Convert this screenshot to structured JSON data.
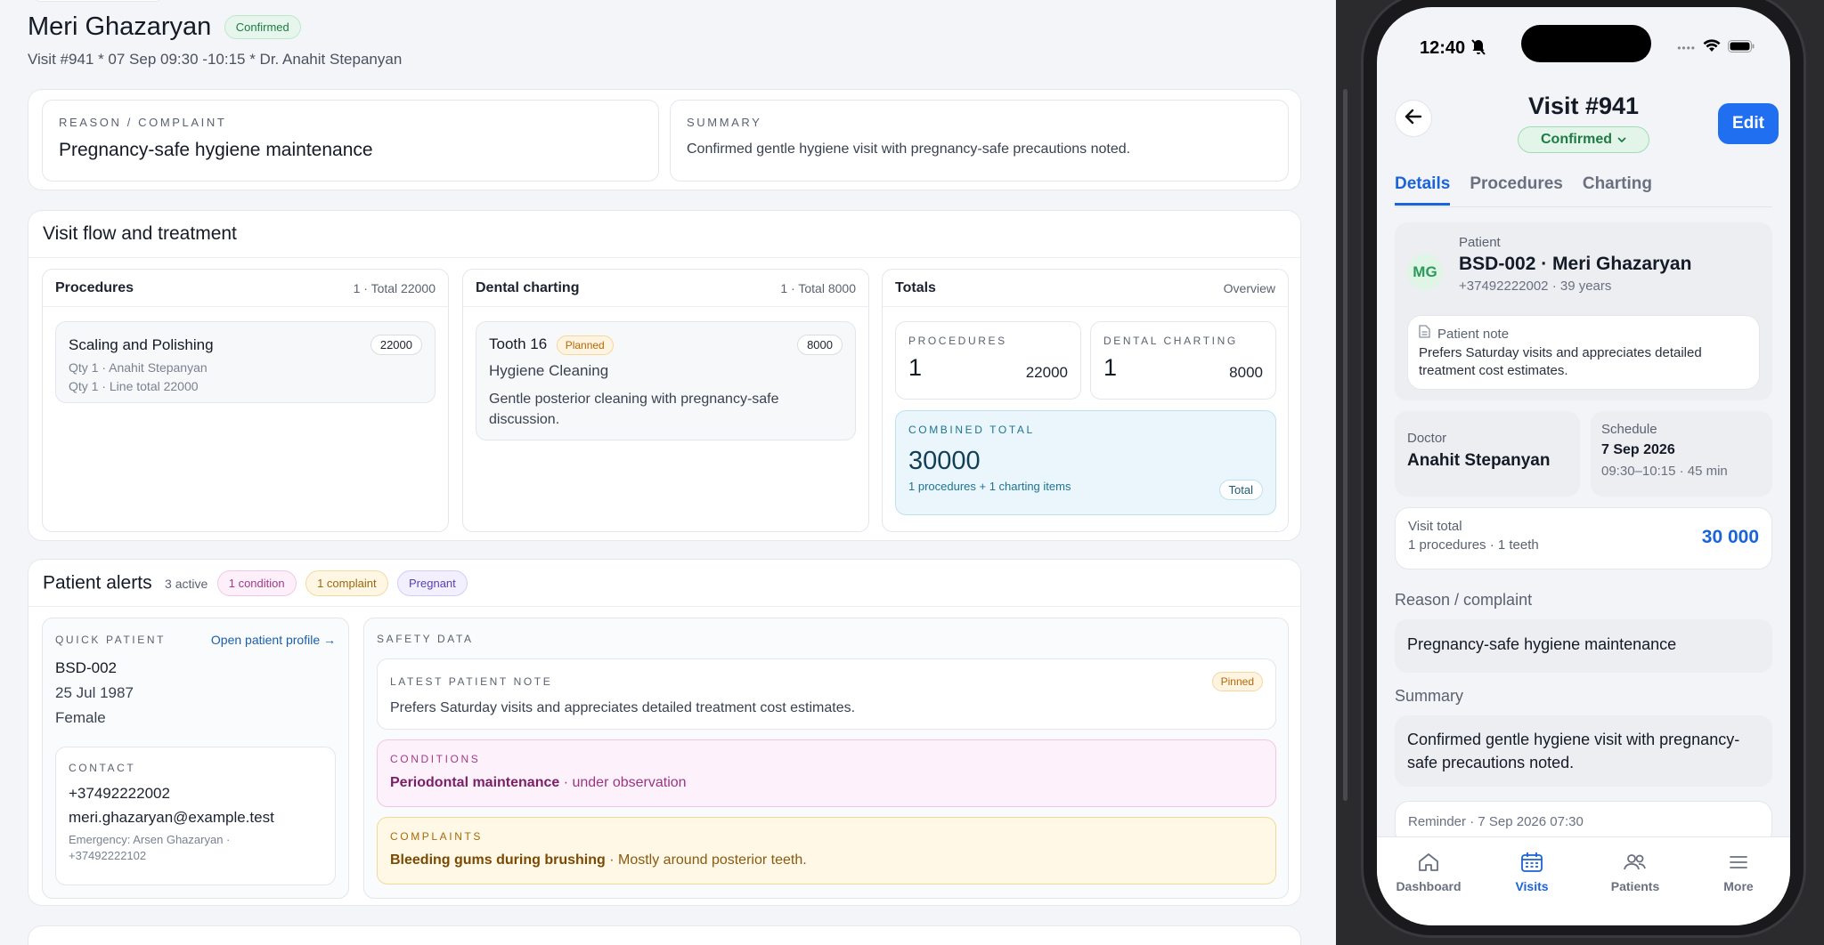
{
  "desktop": {
    "patient_name": "Meri Ghazaryan",
    "status": "Confirmed",
    "visit_meta": "Visit #941 *  07 Sep 09:30  -10:15  * Dr. Anahit Stepanyan",
    "reason": {
      "caption": "REASON / COMPLAINT",
      "value": "Pregnancy-safe hygiene maintenance"
    },
    "summary": {
      "caption": "SUMMARY",
      "value": "Confirmed gentle hygiene visit with pregnancy-safe precautions noted."
    },
    "flow": {
      "title": "Visit flow and treatment",
      "procedures": {
        "title": "Procedures",
        "meta": "1 · Total 22000",
        "item": {
          "name": "Scaling and Polishing",
          "amount": "22000",
          "line1": "Qty 1 · Anahit Stepanyan",
          "line2": "Qty 1 · Line total 22000"
        }
      },
      "charting": {
        "title": "Dental charting",
        "meta": "1 · Total 8000",
        "item": {
          "tooth": "Tooth 16",
          "status": "Planned",
          "amount": "8000",
          "service": "Hygiene Cleaning",
          "note": "Gentle posterior cleaning with pregnancy-safe discussion."
        }
      },
      "totals": {
        "title": "Totals",
        "meta": "Overview",
        "procedures_caption": "PROCEDURES",
        "procedures_count": "1",
        "procedures_amount": "22000",
        "charting_caption": "DENTAL CHARTING",
        "charting_count": "1",
        "charting_amount": "8000",
        "combined_caption": "COMBINED TOTAL",
        "combined_value": "30000",
        "combined_detail": "1 procedures + 1 charting items",
        "combined_badge": "Total"
      }
    },
    "alerts": {
      "title": "Patient alerts",
      "count": "3 active",
      "chips": [
        "1 condition",
        "1 complaint",
        "Pregnant"
      ],
      "quick": {
        "caption": "QUICK PATIENT",
        "link": "Open patient profile →",
        "code": "BSD-002",
        "dob": "25 Jul 1987",
        "sex": "Female",
        "contact_caption": "CONTACT",
        "phone": "+37492222002",
        "email": "meri.ghazaryan@example.test",
        "emergency": "Emergency: Arsen Ghazaryan ·",
        "emergency_phone": "+37492222102"
      },
      "safety": {
        "caption": "SAFETY DATA",
        "note_caption": "LATEST PATIENT NOTE",
        "note_badge": "Pinned",
        "note": "Prefers Saturday visits and appreciates detailed treatment cost estimates.",
        "conditions_caption": "CONDITIONS",
        "condition_name": "Periodontal maintenance",
        "condition_detail": " · under observation",
        "complaints_caption": "COMPLAINTS",
        "complaint_name": "Bleeding gums during brushing",
        "complaint_detail": " · Mostly around posterior teeth."
      }
    }
  },
  "phone": {
    "time": "12:40",
    "title": "Visit #941",
    "status": "Confirmed",
    "edit": "Edit",
    "tabs": [
      "Details",
      "Procedures",
      "Charting"
    ],
    "patient": {
      "caption": "Patient",
      "initials": "MG",
      "name": "BSD-002 · Meri Ghazaryan",
      "detail": "+37492222002 · 39 years",
      "note_caption": "Patient note",
      "note": "Prefers Saturday visits and appreciates detailed treatment cost estimates."
    },
    "doctor": {
      "caption": "Doctor",
      "name": "Anahit Stepanyan"
    },
    "schedule": {
      "caption": "Schedule",
      "date": "7 Sep 2026",
      "time": "09:30–10:15 · 45 min"
    },
    "visit_total": {
      "caption": "Visit total",
      "detail": "1 procedures · 1 teeth",
      "value": "30 000"
    },
    "reason_caption": "Reason / complaint",
    "reason": "Pregnancy-safe hygiene maintenance",
    "summary_caption": "Summary",
    "summary": "Confirmed gentle hygiene visit with pregnancy-safe precautions noted.",
    "reminder": "Reminder · 7 Sep 2026 07:30",
    "tabbar": [
      "Dashboard",
      "Visits",
      "Patients",
      "More"
    ]
  },
  "colors": {
    "accent": "#1a63d8",
    "confirmed": "#1f7a45",
    "combined_bg": "#eaf6fb"
  }
}
